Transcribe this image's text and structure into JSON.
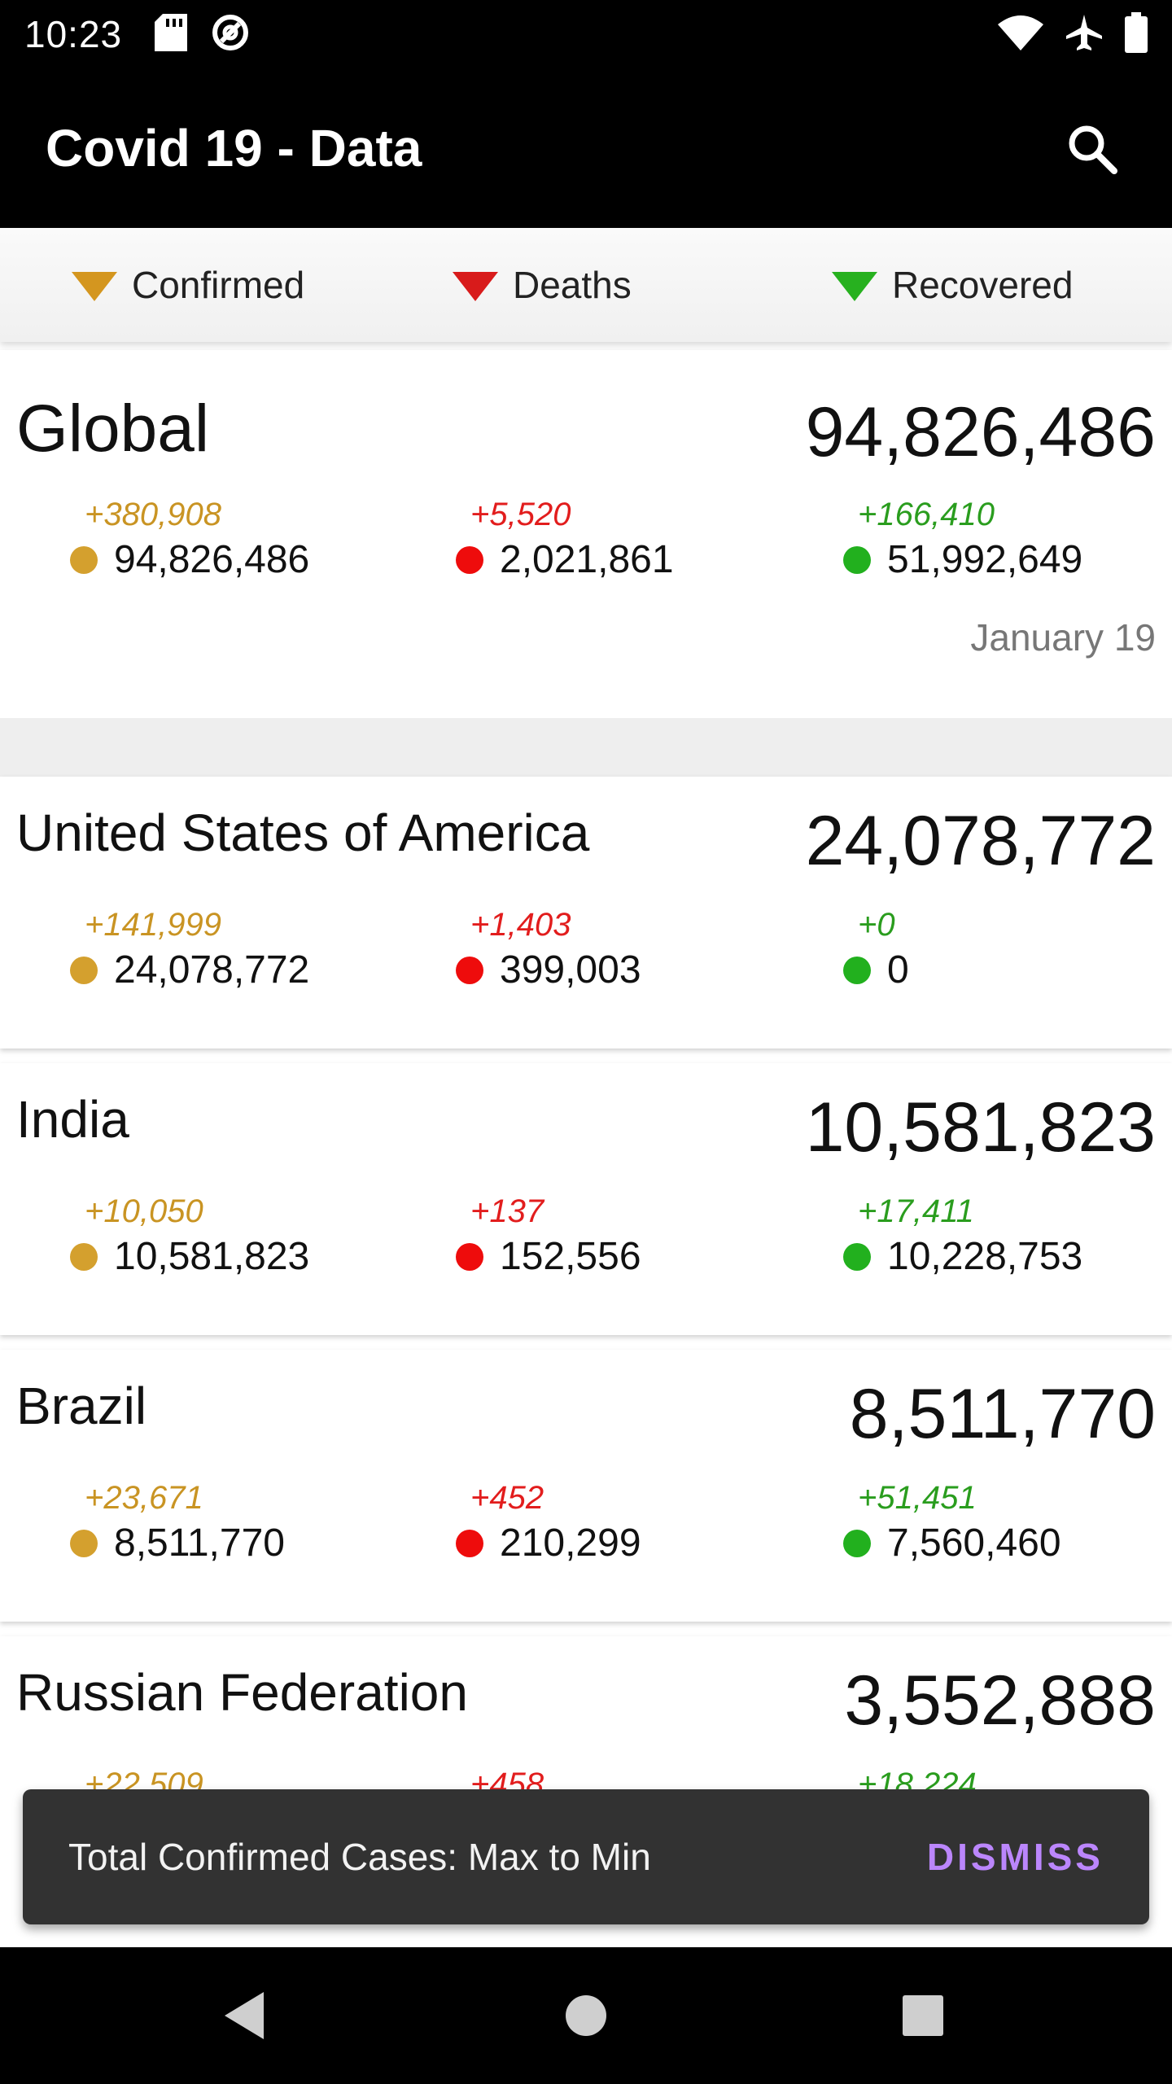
{
  "status_bar": {
    "time": "10:23"
  },
  "app_bar": {
    "title": "Covid 19 - Data"
  },
  "sort_bar": {
    "confirmed": "Confirmed",
    "deaths": "Deaths",
    "recovered": "Recovered"
  },
  "colors": {
    "confirmed": "#c99423",
    "deaths": "#e21d1d",
    "recovered": "#2a9d1e",
    "snackbar_action": "#bb86fc"
  },
  "global": {
    "name": "Global",
    "total": "94,826,486",
    "confirmed_delta": "+380,908",
    "confirmed": "94,826,486",
    "deaths_delta": "+5,520",
    "deaths": "2,021,861",
    "recovered_delta": "+166,410",
    "recovered": "51,992,649",
    "date": "January 19"
  },
  "countries": [
    {
      "name": "United States of America",
      "total": "24,078,772",
      "confirmed_delta": "+141,999",
      "confirmed": "24,078,772",
      "deaths_delta": "+1,403",
      "deaths": "399,003",
      "recovered_delta": "+0",
      "recovered": "0"
    },
    {
      "name": "India",
      "total": "10,581,823",
      "confirmed_delta": "+10,050",
      "confirmed": "10,581,823",
      "deaths_delta": "+137",
      "deaths": "152,556",
      "recovered_delta": "+17,411",
      "recovered": "10,228,753"
    },
    {
      "name": "Brazil",
      "total": "8,511,770",
      "confirmed_delta": "+23,671",
      "confirmed": "8,511,770",
      "deaths_delta": "+452",
      "deaths": "210,299",
      "recovered_delta": "+51,451",
      "recovered": "7,560,460"
    },
    {
      "name": "Russian Federation",
      "total": "3,552,888",
      "confirmed_delta": "+22,509",
      "deaths_delta": "+458",
      "recovered_delta": "+18,224"
    }
  ],
  "snackbar": {
    "message": "Total Confirmed Cases: Max to Min",
    "action": "DISMISS"
  }
}
